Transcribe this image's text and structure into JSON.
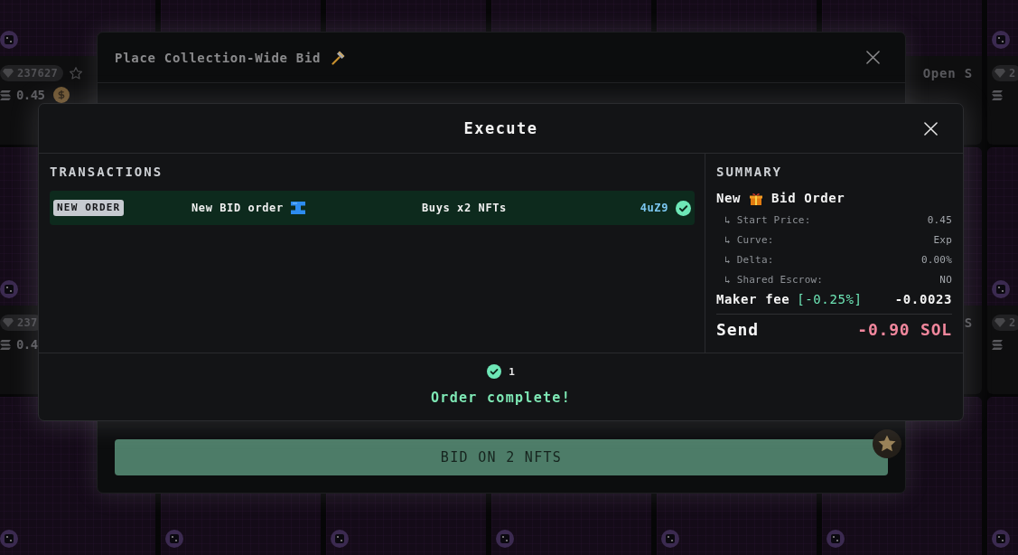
{
  "nft_grid": {
    "rows": [
      {
        "cards": [
          {
            "rank": "237627",
            "price": "0.45"
          },
          {
            "name": "Open S"
          },
          {
            "rank": "2"
          }
        ]
      },
      {
        "cards": [
          {
            "rank": "237",
            "price": "0.4"
          },
          {
            "name": "S"
          },
          {
            "rank": "2"
          }
        ]
      }
    ]
  },
  "bid_dialog": {
    "title": "Place Collection-Wide Bid",
    "submit_button": "BID ON 2 NFTS"
  },
  "execute_dialog": {
    "title": "Execute",
    "transactions": {
      "heading": "TRANSACTIONS",
      "rows": [
        {
          "type_badge": "NEW ORDER",
          "description": "New BID order",
          "detail": "Buys x2 NFTs",
          "signature": "4uZ9",
          "confirmed": true
        }
      ]
    },
    "summary": {
      "heading": "SUMMARY",
      "order_title": [
        "New",
        "Bid Order"
      ],
      "lines": [
        {
          "label": "↳ Start Price:",
          "value": "0.45"
        },
        {
          "label": "↳ Curve:",
          "value": "Exp"
        },
        {
          "label": "↳ Delta:",
          "value": "0.00%"
        },
        {
          "label": "↳ Shared Escrow:",
          "value": "NO"
        }
      ],
      "fee": {
        "label": "Maker fee",
        "rate": "[-0.25%]",
        "value": "-0.0023"
      },
      "total": {
        "label": "Send",
        "value": "-0.90 SOL"
      }
    },
    "footer": {
      "complete": true,
      "count": "1",
      "status": "Order complete!"
    }
  }
}
